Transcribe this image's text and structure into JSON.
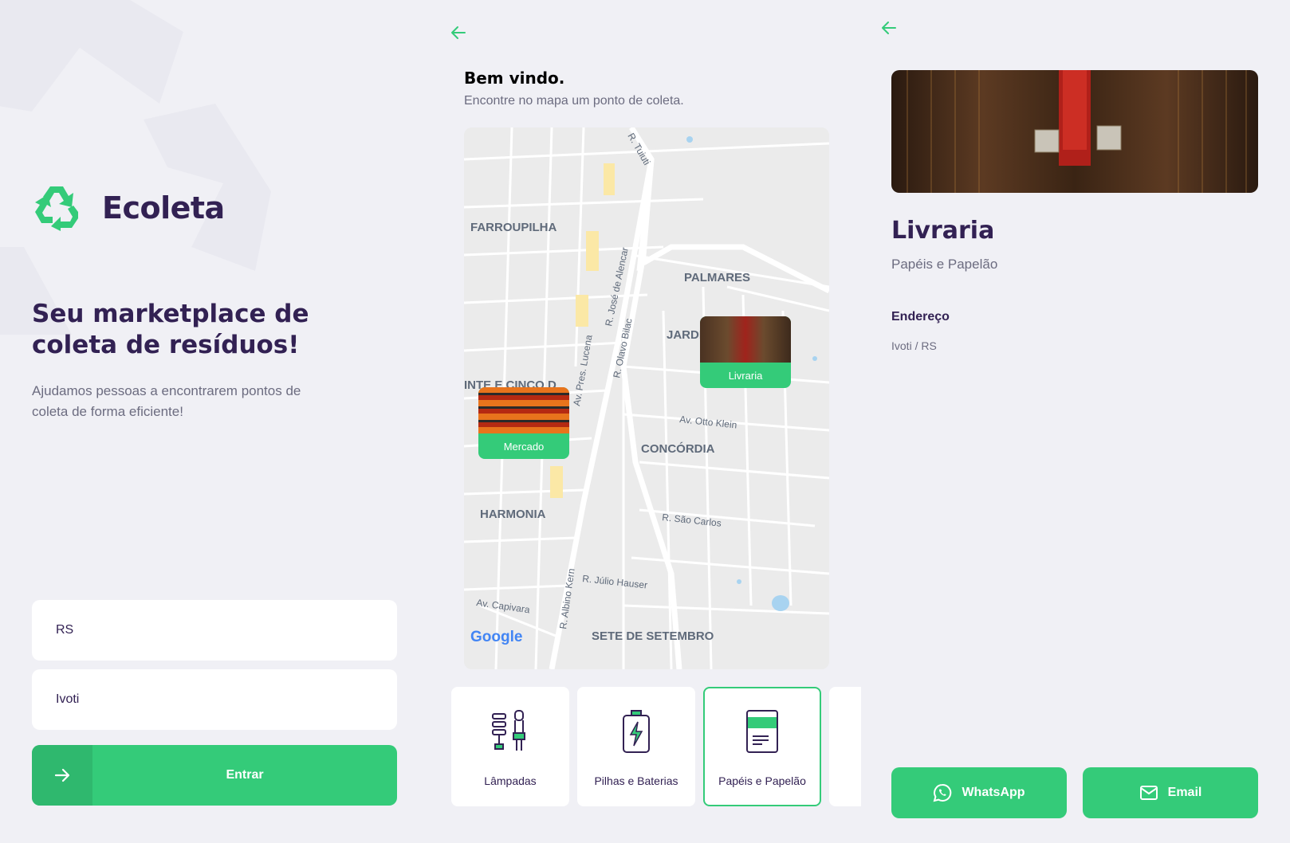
{
  "home": {
    "app_name": "Ecoleta",
    "headline": "Seu marketplace de coleta de resíduos!",
    "subtitle": "Ajudamos pessoas a encontrarem pontos de coleta de forma eficiente!",
    "uf_value": "RS",
    "city_value": "Ivoti",
    "enter_label": "Entrar",
    "accent": "#34cb79",
    "title_color": "#322153"
  },
  "points": {
    "welcome": "Bem vindo.",
    "description": "Encontre no mapa um ponto de coleta.",
    "map": {
      "districts": [
        "FARROUPILHA",
        "PALMARES",
        "JARDI",
        "INTE E CINCO D",
        "CONCÓRDIA",
        "HARMONIA",
        "SETE DE SETEMBRO"
      ],
      "streets": [
        "R. Tuiuti",
        "R. José de Alencar",
        "R. Olavo Bilac",
        "Av. Pres. Lucena",
        "Av. Otto Klein",
        "R. São Carlos",
        "R. Júlio Hauser",
        "R. Albino Kern",
        "Av. Capivara"
      ],
      "attribution": "Google",
      "markers": [
        {
          "label": "Livraria"
        },
        {
          "label": "Mercado"
        }
      ]
    },
    "items": [
      {
        "label": "Lâmpadas",
        "icon": "lamp-icon"
      },
      {
        "label": "Pilhas e Baterias",
        "icon": "battery-icon"
      },
      {
        "label": "Papéis e Papelão",
        "icon": "paper-icon",
        "selected": true
      }
    ]
  },
  "detail": {
    "name": "Livraria",
    "items": "Papéis e Papelão",
    "address_title": "Endereço",
    "address": "Ivoti / RS",
    "whatsapp_label": "WhatsApp",
    "email_label": "Email"
  }
}
